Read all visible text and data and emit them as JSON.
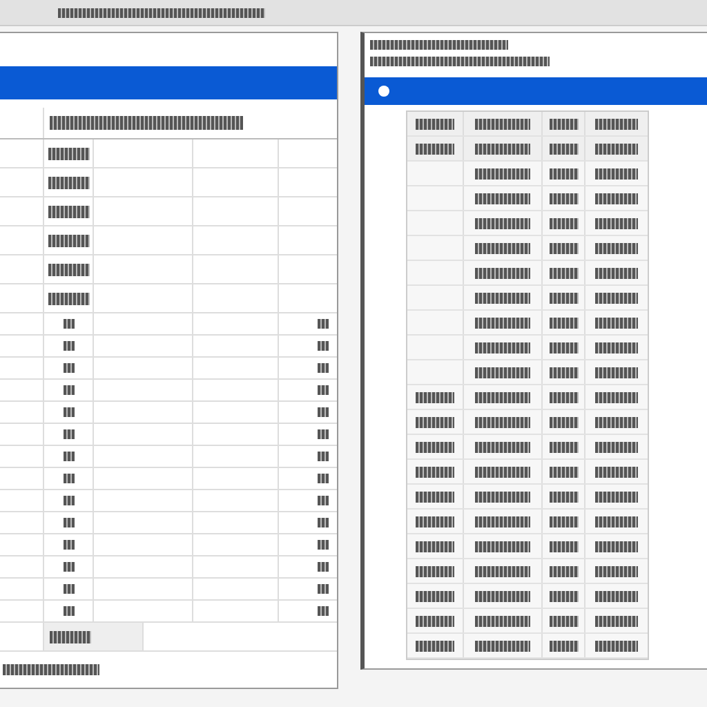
{
  "toolbar": {
    "kind": "blurred"
  },
  "left_window": {
    "header": {
      "kind": "blurred"
    },
    "rows": [
      {
        "kind": "labeled"
      },
      {
        "kind": "labeled"
      },
      {
        "kind": "labeled"
      },
      {
        "kind": "labeled"
      },
      {
        "kind": "labeled"
      },
      {
        "kind": "labeled"
      },
      {
        "kind": "marked"
      },
      {
        "kind": "marked"
      },
      {
        "kind": "marked"
      },
      {
        "kind": "marked"
      },
      {
        "kind": "marked"
      },
      {
        "kind": "marked"
      },
      {
        "kind": "marked"
      },
      {
        "kind": "marked"
      },
      {
        "kind": "marked"
      },
      {
        "kind": "marked"
      },
      {
        "kind": "marked"
      },
      {
        "kind": "marked"
      },
      {
        "kind": "marked"
      },
      {
        "kind": "marked"
      }
    ],
    "total_row": {
      "kind": "labeled"
    },
    "status_bar": {
      "kind": "blurred"
    }
  },
  "right_window": {
    "title_lines": [
      {
        "kind": "short"
      },
      {
        "kind": "long"
      }
    ],
    "rows": [
      {
        "kind": "header"
      },
      {
        "kind": "header"
      },
      {
        "kind": "sparse"
      },
      {
        "kind": "sparse"
      },
      {
        "kind": "sparse"
      },
      {
        "kind": "sparse"
      },
      {
        "kind": "sparse"
      },
      {
        "kind": "sparse"
      },
      {
        "kind": "sparse"
      },
      {
        "kind": "sparse"
      },
      {
        "kind": "sparse"
      },
      {
        "kind": "dense"
      },
      {
        "kind": "dense"
      },
      {
        "kind": "dense"
      },
      {
        "kind": "dense"
      },
      {
        "kind": "dense"
      },
      {
        "kind": "dense"
      },
      {
        "kind": "dense"
      },
      {
        "kind": "dense"
      },
      {
        "kind": "dense"
      },
      {
        "kind": "dense"
      },
      {
        "kind": "dense"
      }
    ]
  }
}
